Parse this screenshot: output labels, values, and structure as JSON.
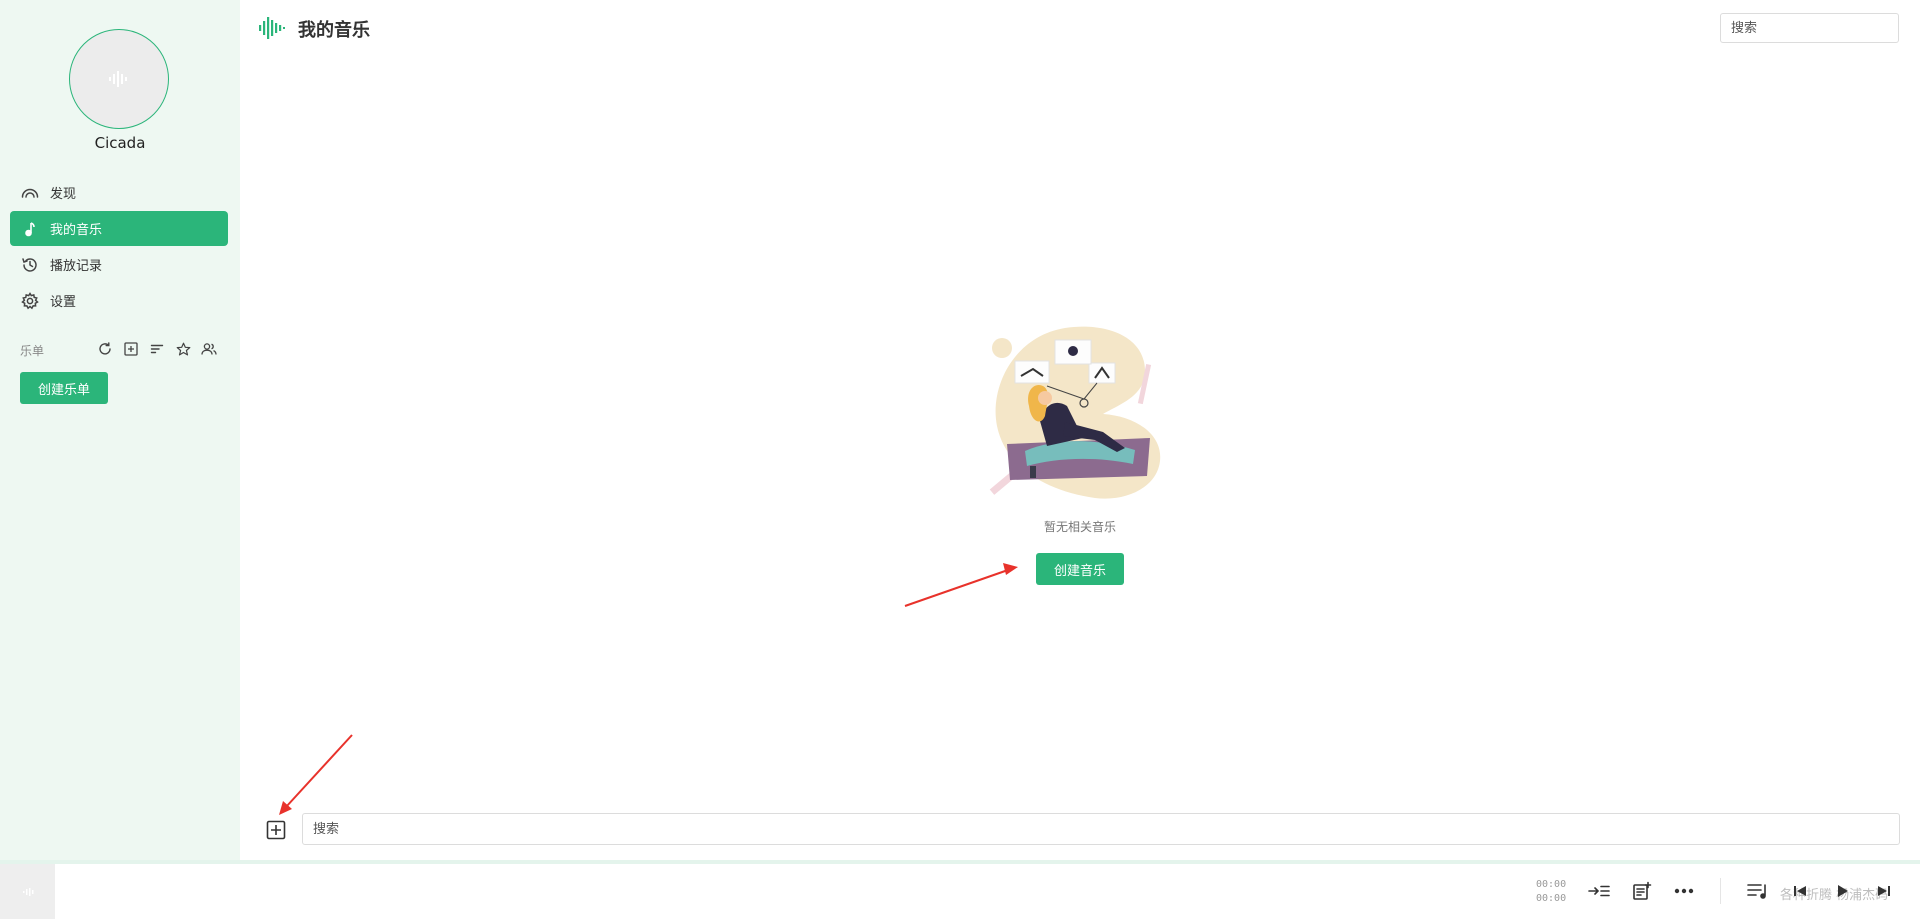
{
  "sidebar": {
    "username": "Cicada",
    "nav": [
      {
        "label": "发现",
        "icon": "discover-icon",
        "active": false
      },
      {
        "label": "我的音乐",
        "icon": "music-note-icon",
        "active": true
      },
      {
        "label": "播放记录",
        "icon": "history-icon",
        "active": false
      },
      {
        "label": "设置",
        "icon": "gear-icon",
        "active": false
      }
    ],
    "section_label": "乐单",
    "section_tools": [
      "refresh-icon",
      "add-box-icon",
      "sort-icon",
      "star-icon",
      "users-icon"
    ],
    "create_playlist_label": "创建乐单"
  },
  "header": {
    "title": "我的音乐",
    "search_placeholder": "搜索"
  },
  "main": {
    "empty_text": "暂无相关音乐",
    "create_music_label": "创建音乐",
    "bottom_search_placeholder": "搜索"
  },
  "player": {
    "current_time": "00:00",
    "total_time": "00:00",
    "watermark": "各种折腾 杨浦杰码"
  },
  "colors": {
    "accent": "#2bb57a",
    "sidebar_bg": "#eef8f2",
    "annotation": "#e8322b"
  }
}
